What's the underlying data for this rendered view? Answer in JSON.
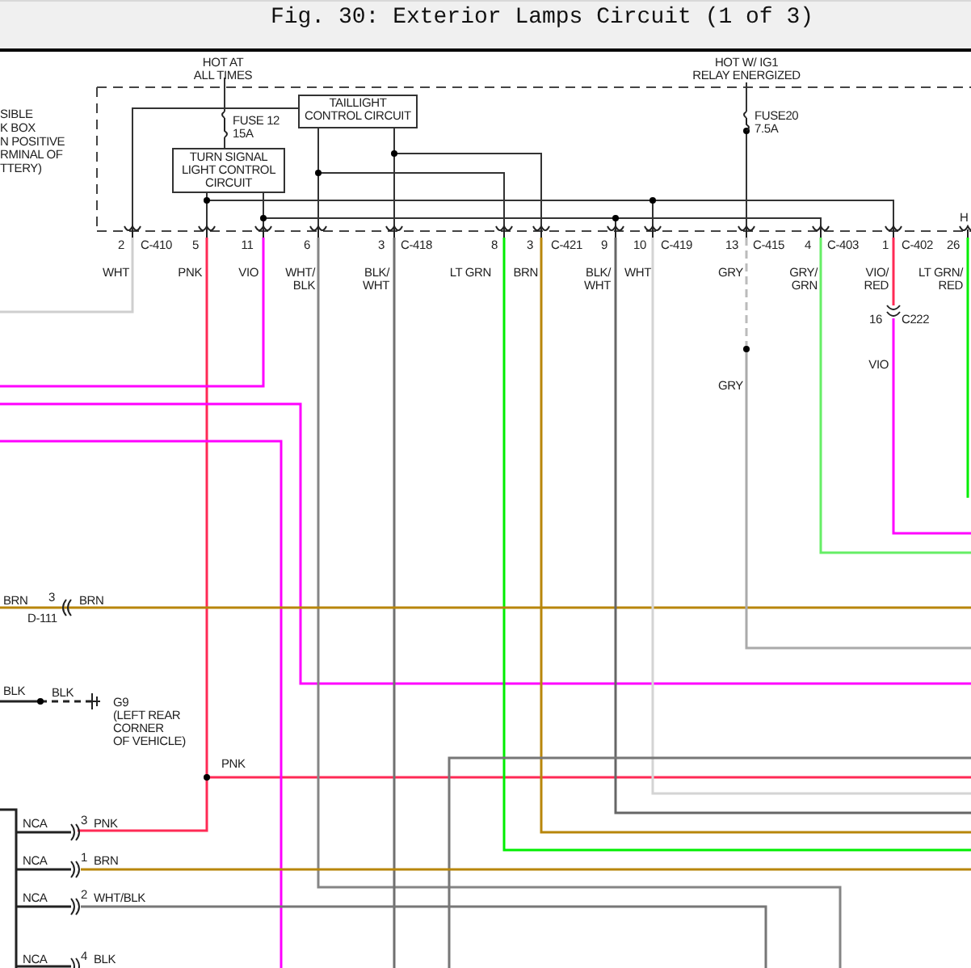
{
  "title": "Fig. 30: Exterior Lamps Circuit (1 of 3)",
  "diagram": {
    "supply_notes": [
      [
        "HOT AT",
        "ALL TIMES"
      ],
      [
        "HOT W/ IG1",
        "RELAY ENERGIZED"
      ]
    ],
    "side_note": [
      "SIBLE",
      "K BOX",
      "N POSITIVE",
      "RMINAL OF",
      "TTERY)"
    ],
    "modules": [
      [
        "TAILLIGHT",
        "CONTROL CIRCUIT"
      ],
      [
        "TURN SIGNAL",
        "LIGHT CONTROL",
        "CIRCUIT"
      ]
    ],
    "fuses": [
      [
        "FUSE 12",
        "15A"
      ],
      [
        "FUSE20",
        "7.5A"
      ]
    ],
    "pins": [
      "2",
      "5",
      "11",
      "6",
      "3",
      "8",
      "3",
      "9",
      "10",
      "13",
      "4",
      "1",
      "26"
    ],
    "connectors": [
      "C-410",
      "C-418",
      "C-421",
      "C-419",
      "C-415",
      "C-403",
      "C-402"
    ],
    "cut_label": "H",
    "wire_colors": [
      [
        "WHT"
      ],
      [
        "PNK"
      ],
      [
        "VIO"
      ],
      [
        "WHT/",
        "BLK"
      ],
      [
        "BLK/",
        "WHT"
      ],
      [
        "LT GRN"
      ],
      [
        "BRN"
      ],
      [
        "BLK/",
        "WHT"
      ],
      [
        "WHT"
      ],
      [
        "GRY"
      ],
      [
        "GRY/",
        "GRN"
      ],
      [
        "VIO/",
        "RED"
      ],
      [
        "LT GRN/",
        "RED"
      ]
    ],
    "inline_connector": {
      "pin": "16",
      "connector": "C222"
    },
    "wire_labels": [
      "VIO",
      "GRY",
      "PNK",
      "BRN",
      "BRN",
      "BLK",
      "BLK"
    ],
    "d111": {
      "pin": "3",
      "connector": "D-111"
    },
    "ground": [
      "G9",
      "(LEFT REAR",
      "CORNER",
      "OF VEHICLE)"
    ],
    "nca_rows": [
      [
        "NCA",
        "3",
        "PNK"
      ],
      [
        "NCA",
        "1",
        "BRN"
      ],
      [
        "NCA",
        "2",
        "WHT/BLK"
      ],
      [
        "NCA",
        "4",
        "BLK"
      ]
    ]
  }
}
